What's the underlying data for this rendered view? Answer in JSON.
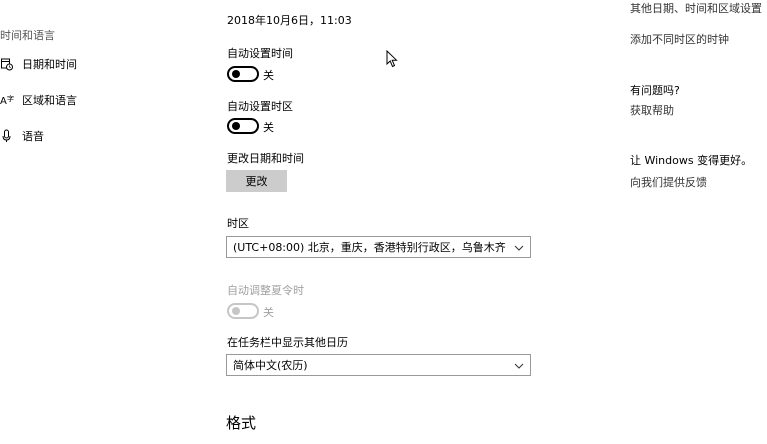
{
  "sidebar": {
    "header": "时间和语言",
    "items": [
      {
        "label": "日期和时间",
        "icon": "clock-calendar-icon"
      },
      {
        "label": "区域和语言",
        "icon": "region-language-icon"
      },
      {
        "label": "语音",
        "icon": "microphone-icon"
      }
    ]
  },
  "main": {
    "current_datetime": "2018年10月6日，11:03",
    "auto_time": {
      "label": "自动设置时间",
      "state": "关"
    },
    "auto_timezone": {
      "label": "自动设置时区",
      "state": "关"
    },
    "change_datetime": {
      "label": "更改日期和时间",
      "button": "更改"
    },
    "timezone": {
      "label": "时区",
      "value": "(UTC+08:00) 北京，重庆，香港特别行政区，乌鲁木齐"
    },
    "dst": {
      "label": "自动调整夏令时",
      "state": "关"
    },
    "calendar": {
      "label": "在任务栏中显示其他日历",
      "value": "简体中文(农历)"
    },
    "format_section": "格式"
  },
  "right": {
    "related_link_1": "其他日期、时间和区域设置",
    "related_link_2": "添加不同时区的时钟",
    "question_heading": "有问题吗?",
    "get_help": "获取帮助",
    "feedback_heading": "让 Windows 变得更好。",
    "feedback_link": "向我们提供反馈"
  },
  "colors": {
    "button_bg": "#cccccc",
    "disabled": "#a0a0a0",
    "border": "#999999"
  }
}
